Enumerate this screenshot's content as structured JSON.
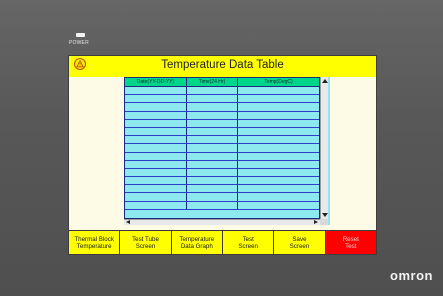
{
  "device": {
    "power_label": "POWER",
    "brand": "omron"
  },
  "screen": {
    "title": "Temperature Data Table",
    "title_icon": "warning-icon",
    "title_icon_caption": "",
    "table": {
      "columns": [
        "Date(YY-DD-YY)",
        "Time(24 Hr)",
        "Temp(DegC)"
      ],
      "rows": [
        [
          "",
          "",
          ""
        ],
        [
          "",
          "",
          ""
        ],
        [
          "",
          "",
          ""
        ],
        [
          "",
          "",
          ""
        ],
        [
          "",
          "",
          ""
        ],
        [
          "",
          "",
          ""
        ],
        [
          "",
          "",
          ""
        ],
        [
          "",
          "",
          ""
        ],
        [
          "",
          "",
          ""
        ],
        [
          "",
          "",
          ""
        ],
        [
          "",
          "",
          ""
        ],
        [
          "",
          "",
          ""
        ],
        [
          "",
          "",
          ""
        ],
        [
          "",
          "",
          ""
        ],
        [
          "",
          "",
          ""
        ]
      ]
    },
    "buttons": [
      {
        "label": "Thermal Block\nTemperature",
        "name": "thermal-block-temperature-button"
      },
      {
        "label": "Test Tube\nScreen",
        "name": "test-tube-screen-button"
      },
      {
        "label": "Temperature\nData Graph",
        "name": "temperature-data-graph-button"
      },
      {
        "label": "Test\nScreen",
        "name": "test-screen-button"
      },
      {
        "label": "Save\nScreen",
        "name": "save-screen-button"
      },
      {
        "label": "Reset\nTest",
        "name": "reset-test-button"
      }
    ]
  },
  "colors": {
    "title_bar": "#ffff00",
    "table_bg": "#8ee9ee",
    "table_header": "#00d68a",
    "reset_button": "#ff0000",
    "bezel": "#5a5a5a"
  }
}
